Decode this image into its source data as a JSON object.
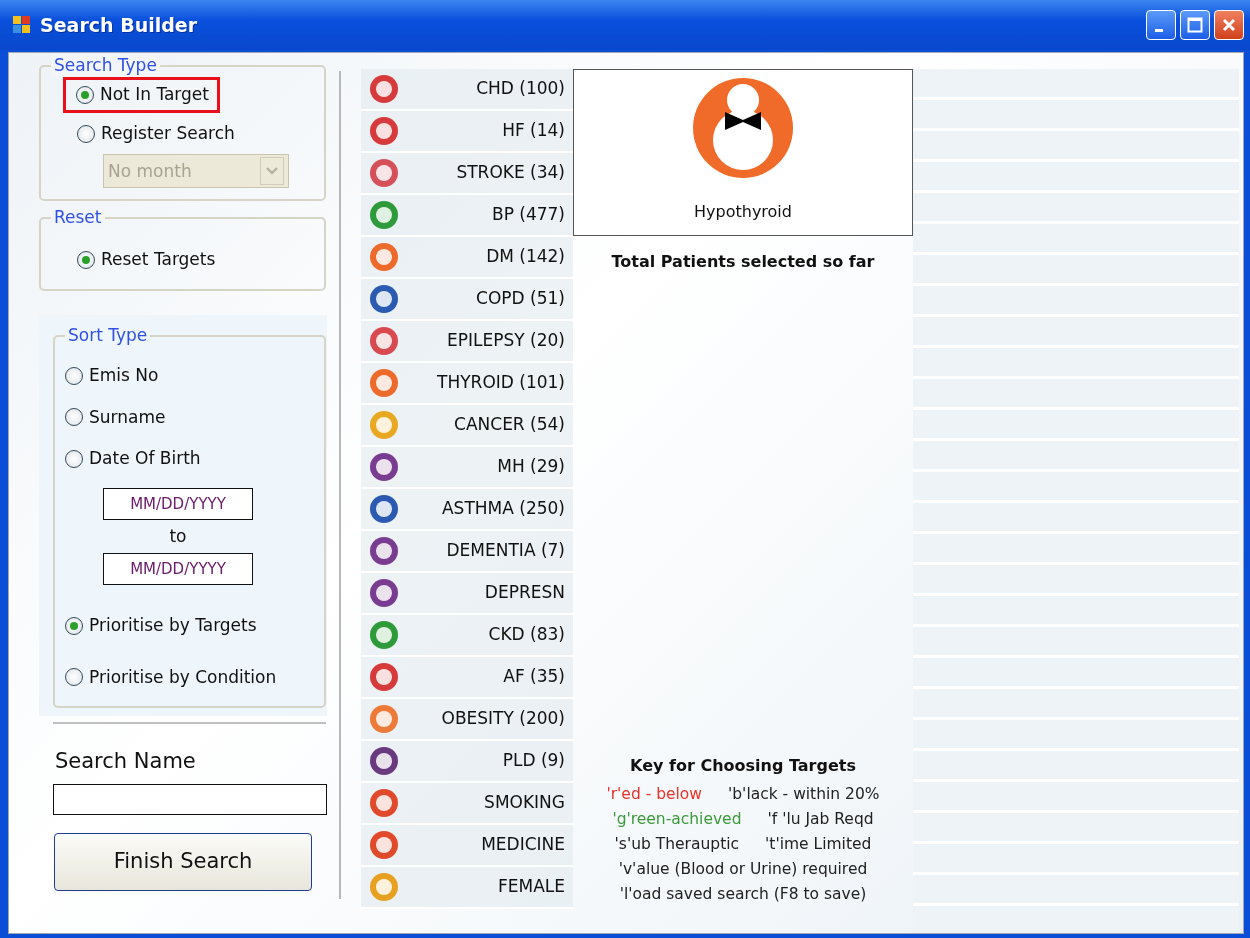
{
  "window": {
    "title": "Search Builder"
  },
  "search_type": {
    "title": "Search Type",
    "options": [
      {
        "label": "Not In Target",
        "selected": true,
        "highlighted": true
      },
      {
        "label": "Register Search",
        "selected": false,
        "highlighted": false
      }
    ],
    "month_select": {
      "value": "No month",
      "disabled": true
    }
  },
  "reset": {
    "title": "Reset",
    "options": [
      {
        "label": "Reset Targets",
        "selected": true
      }
    ]
  },
  "sort_type": {
    "title": "Sort Type",
    "options": [
      {
        "kind": "radio",
        "label": "Emis No",
        "selected": false
      },
      {
        "kind": "radio",
        "label": "Surname",
        "selected": false
      },
      {
        "kind": "radio",
        "label": "Date Of Birth",
        "selected": false
      },
      {
        "kind": "daterange",
        "from_placeholder": "MM/DD/YYYY",
        "separator": "to",
        "to_placeholder": "MM/DD/YYYY"
      },
      {
        "kind": "radio",
        "label": "Prioritise by Targets",
        "selected": true
      },
      {
        "kind": "radio",
        "label": "Prioritise by Condition",
        "selected": false
      }
    ]
  },
  "search_name": {
    "label": "Search Name"
  },
  "finish_button": "Finish Search",
  "conditions": [
    {
      "label": "CHD (100)",
      "color": "#d63a3a"
    },
    {
      "label": "HF (14)",
      "color": "#d63a3a"
    },
    {
      "label": "STROKE (34)",
      "color": "#d6505a"
    },
    {
      "label": "BP (477)",
      "color": "#2f9a3a"
    },
    {
      "label": "DM (142)",
      "color": "#ee6a2a"
    },
    {
      "label": "COPD (51)",
      "color": "#2a5bb0"
    },
    {
      "label": "EPILEPSY (20)",
      "color": "#d84a50"
    },
    {
      "label": "THYROID (101)",
      "color": "#ee6a2a"
    },
    {
      "label": "CANCER (54)",
      "color": "#e8a820"
    },
    {
      "label": "MH (29)",
      "color": "#7a3c90"
    },
    {
      "label": "ASTHMA (250)",
      "color": "#2a5bb0"
    },
    {
      "label": "DEMENTIA (7)",
      "color": "#7a3c90"
    },
    {
      "label": "DEPRESN",
      "color": "#7a3c90"
    },
    {
      "label": "CKD (83)",
      "color": "#2f9a3a"
    },
    {
      "label": "AF (35)",
      "color": "#d63a3a"
    },
    {
      "label": "OBESITY (200)",
      "color": "#ee7a3a"
    },
    {
      "label": "PLD (9)",
      "color": "#6a3a80"
    },
    {
      "label": "SMOKING",
      "color": "#e04a2a"
    },
    {
      "label": "MEDICINE",
      "color": "#e04a2a"
    },
    {
      "label": "FEMALE",
      "color": "#e8a020"
    }
  ],
  "preview": {
    "caption": "Hypothyroid"
  },
  "total_label": "Total Patients selected so far",
  "key": {
    "title": "Key for Choosing Targets",
    "rows": [
      [
        {
          "text": "'r'ed - below",
          "color": "#e8322a"
        },
        {
          "text": "'b'lack - within 20%",
          "color": "#222222"
        }
      ],
      [
        {
          "text": "'g'reen-achieved",
          "color": "#3a9a3a"
        },
        {
          "text": "'f 'lu Jab Reqd",
          "color": "#222222"
        }
      ],
      [
        {
          "text": "'s'ub Therauptic",
          "color": "#222222"
        },
        {
          "text": "'t'ime Limited",
          "color": "#222222"
        }
      ],
      [
        {
          "text": "'v'alue (Blood or Urine) required",
          "color": "#222222"
        }
      ],
      [
        {
          "text": "'l'oad saved search (F8 to save)",
          "color": "#222222"
        }
      ]
    ]
  }
}
